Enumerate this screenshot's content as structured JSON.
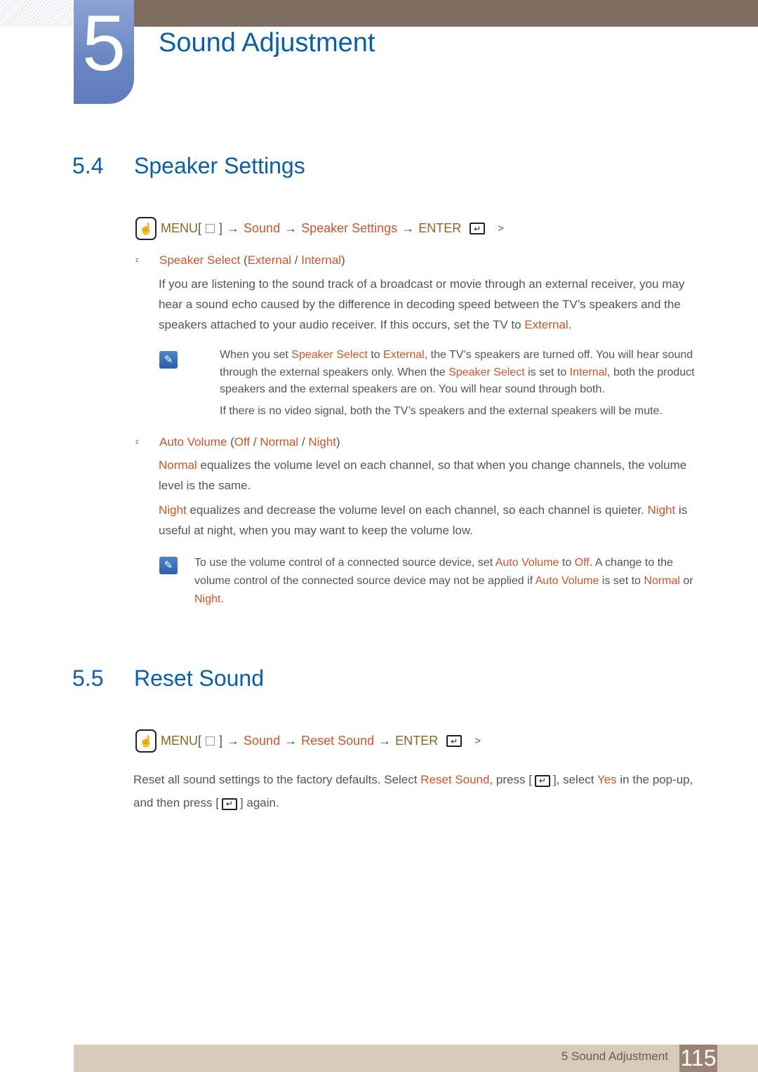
{
  "chapter": {
    "number": "5",
    "title": "Sound Adjustment"
  },
  "sections": [
    {
      "number": "5.4",
      "title": "Speaker Settings",
      "menu_path": {
        "menu": "MENU",
        "step1": "Sound",
        "step2": "Speaker Settings",
        "enter": "ENTER",
        "tail": ">"
      },
      "items": [
        {
          "heading": {
            "name": "Speaker Select",
            "opt1": "External",
            "opt2": "Internal"
          },
          "body": {
            "text": "If you are listening to the sound track of a broadcast or movie through an external receiver, you may hear a sound echo caused by the difference in decoding speed between the TV’s speakers and the speakers attached to your audio receiver. If this occurs, set the TV to ",
            "highlight": "External",
            "end": "."
          },
          "note": {
            "p1_a": "When you set ",
            "p1_b": "Speaker Select",
            "p1_c": " to ",
            "p1_d": "External",
            "p1_e": ", the TV’s speakers are turned off. You will hear sound through the external speakers only. When the ",
            "p1_f": "Speaker Select",
            "p1_g": " is set to ",
            "p1_h": "Internal",
            "p1_i": ", both the product speakers and the external speakers are on. You will hear sound through both.",
            "p2": "If there is no video signal, both the TV’s speakers and the external speakers will be mute."
          }
        },
        {
          "heading": {
            "name": "Auto Volume",
            "opt1": "Off",
            "opt2": "Normal",
            "opt3": "Night"
          },
          "body1": {
            "highlight": "Normal",
            "text": " equalizes the volume level on each channel, so that when you change channels, the volume level is the same."
          },
          "body2": {
            "highlight": "Night",
            "text": " equalizes and decrease the volume level on each channel, so each channel is quieter. ",
            "highlight2": "Night",
            "text2": " is useful at night, when you may want to keep the volume low."
          },
          "note": {
            "a": "To use the volume control of a connected source device, set ",
            "b": "Auto Volume",
            "c": " to ",
            "d": "Off",
            "e": ". A change to the volume control of the connected source device may not be applied if ",
            "f": "Auto Volume",
            "g": " is set to ",
            "h": "Normal",
            "i": " or ",
            "j": "Night",
            "k": "."
          }
        }
      ]
    },
    {
      "number": "5.5",
      "title": "Reset Sound",
      "menu_path": {
        "menu": "MENU",
        "step1": "Sound",
        "step2": "Reset Sound",
        "enter": "ENTER",
        "tail": ">"
      },
      "body": {
        "a": "Reset all sound settings to the factory defaults. Select ",
        "b": "Reset Sound",
        "c": ", press [",
        "d": "], select ",
        "e": "Yes",
        "f": " in the pop-up, and then press [",
        "g": "] again."
      }
    }
  ],
  "footer": {
    "label": "5 Sound Adjustment",
    "page": "115"
  }
}
